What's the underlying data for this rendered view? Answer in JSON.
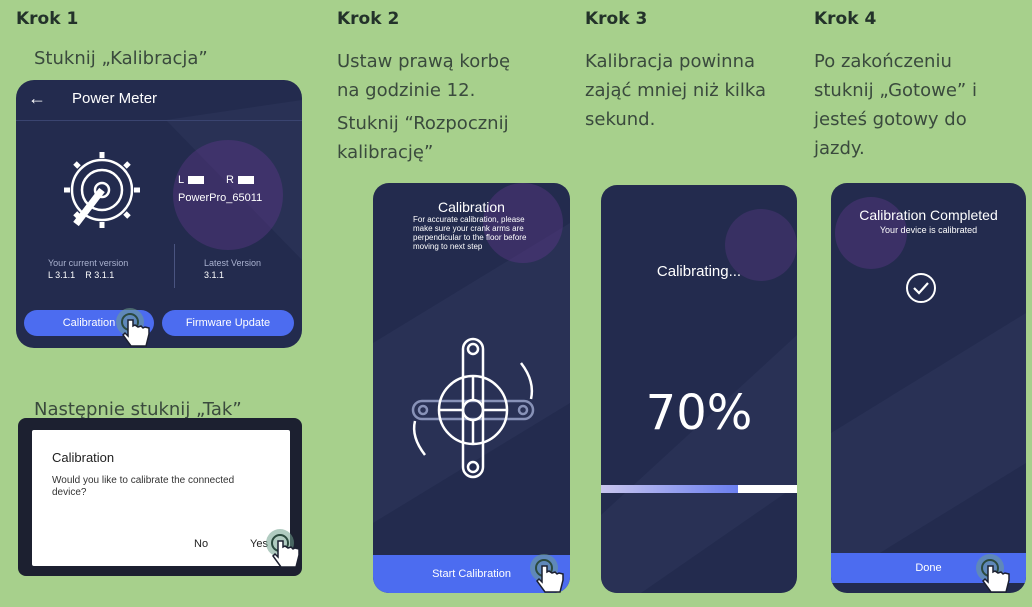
{
  "steps": [
    {
      "heading": "Krok 1",
      "instruction": "Stuknij „Kalibracja”",
      "instruction2": "Następnie stuknij „Tak”"
    },
    {
      "heading": "Krok 2",
      "instruction_lines": [
        "Ustaw prawą korbę",
        "na godzinie 12.",
        "Stuknij “Rozpocznij",
        "kalibrację”"
      ]
    },
    {
      "heading": "Krok 3",
      "instruction_lines": [
        "Kalibracja powinna",
        "zająć mniej niż kilka",
        "sekund."
      ]
    },
    {
      "heading": "Krok 4",
      "instruction_lines": [
        "Po zakończeniu",
        "stuknij „Gotowe” i",
        "jesteś gotowy do",
        "jazdy."
      ]
    }
  ],
  "screen1": {
    "title": "Power Meter",
    "left_battery": "L",
    "right_battery": "R",
    "device_name": "PowerPro_65011",
    "current_version_label": "Your current version",
    "current_version_value": "L 3.1.1    R 3.1.1",
    "latest_version_label": "Latest Version",
    "latest_version_value": "3.1.1",
    "calibration_button": "Calibration",
    "firmware_button": "Firmware Update"
  },
  "dialog": {
    "title": "Calibration",
    "message": "Would you like to calibrate the connected device?",
    "no_button": "No",
    "yes_button": "Yes"
  },
  "screen2": {
    "title": "Calibration",
    "description": "For accurate calibration, please make sure your crank arms are perpendicular to the floor before moving to next step",
    "start_button": "Start Calibration"
  },
  "screen3": {
    "status": "Calibrating...",
    "percent_text": "70%",
    "progress": 0.7
  },
  "screen4": {
    "title": "Calibration Completed",
    "subtitle": "Your device is calibrated",
    "done_button": "Done"
  },
  "colors": {
    "background": "#a7d08c",
    "screen": "#232b4e",
    "accent_blue": "#4c6cf0",
    "accent_purple": "#7a3d9e"
  },
  "icons": [
    "back-arrow-icon",
    "chainring-icon",
    "battery-icon",
    "crank-icon",
    "checkmark-icon",
    "tap-hand-icon"
  ]
}
